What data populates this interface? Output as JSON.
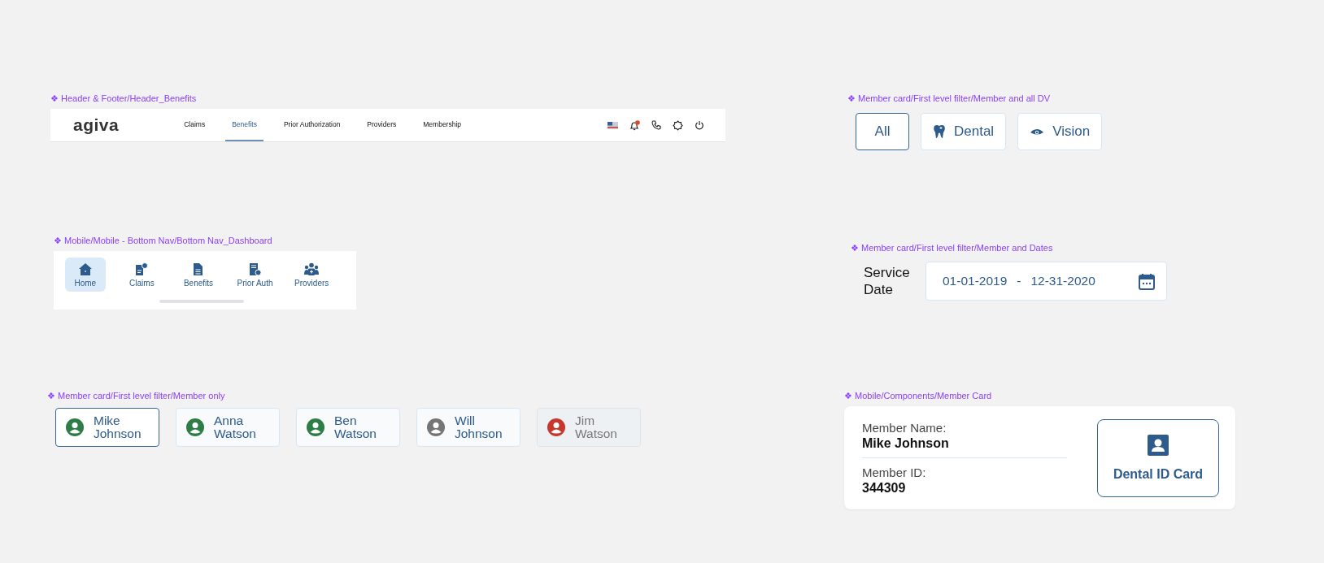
{
  "header_frame": {
    "label": "❖ Header & Footer/Header_Benefits",
    "logo": "agiva",
    "nav": [
      {
        "label": "Claims",
        "selected": false
      },
      {
        "label": "Benefits",
        "selected": true
      },
      {
        "label": "Prior Authorization",
        "selected": false
      },
      {
        "label": "Providers",
        "selected": false
      },
      {
        "label": "Membership",
        "selected": false
      }
    ]
  },
  "bottom_nav_frame": {
    "label": "❖ Mobile/Mobile - Bottom Nav/Bottom Nav_Dashboard",
    "items": [
      {
        "label": "Home",
        "kind": "home",
        "selected": true
      },
      {
        "label": "Claims",
        "kind": "claims",
        "selected": false
      },
      {
        "label": "Benefits",
        "kind": "benefits",
        "selected": false
      },
      {
        "label": "Prior Auth",
        "kind": "prior_auth",
        "selected": false
      },
      {
        "label": "Providers",
        "kind": "providers",
        "selected": false
      }
    ]
  },
  "member_filter_frame": {
    "label": "❖ Member card/First level filter/Member only",
    "members": [
      {
        "name": "Mike Johnson",
        "selected": true,
        "disabled": false,
        "color": "#2e7d46"
      },
      {
        "name": "Anna Watson",
        "selected": false,
        "disabled": false,
        "color": "#2e7d46"
      },
      {
        "name": "Ben Watson",
        "selected": false,
        "disabled": false,
        "color": "#2e7d46"
      },
      {
        "name": "Will Johnson",
        "selected": false,
        "disabled": false,
        "color": "#757575"
      },
      {
        "name": "Jim Watson",
        "selected": false,
        "disabled": true,
        "color": "#c9372c"
      }
    ]
  },
  "coverage_filter_frame": {
    "label": "❖ Member card/First level filter/Member and all DV",
    "options": [
      {
        "label": "All",
        "kind": "all",
        "selected": true
      },
      {
        "label": "Dental",
        "kind": "dental",
        "selected": false
      },
      {
        "label": "Vision",
        "kind": "vision",
        "selected": false
      }
    ]
  },
  "date_filter_frame": {
    "label": "❖ Member card/First level filter/Member and Dates",
    "field_label": "Service Date",
    "start": "01-01-2019",
    "separator": "-",
    "end": "12-31-2020"
  },
  "member_card_frame": {
    "label": "❖ Mobile/Components/Member Card",
    "name_label": "Member Name:",
    "name": "Mike Johnson",
    "id_label": "Member ID:",
    "id": "344309",
    "button": "Dental ID Card"
  }
}
